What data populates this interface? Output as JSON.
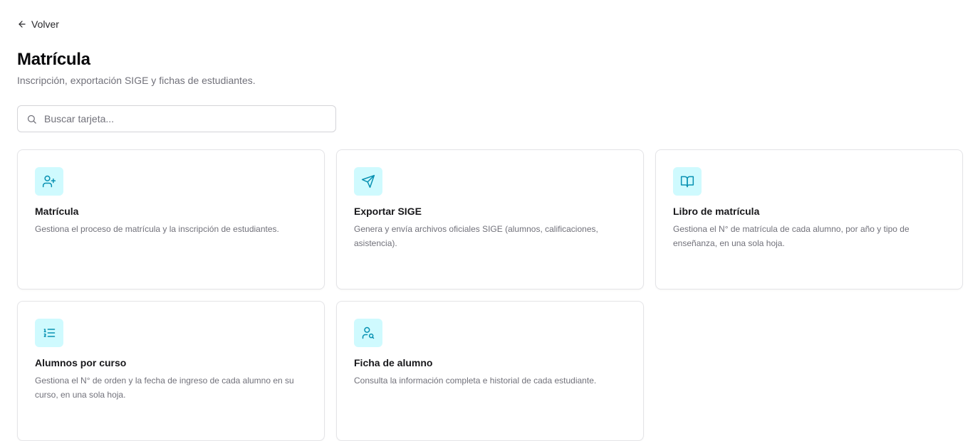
{
  "nav": {
    "back_label": "Volver",
    "back_icon": "arrow-left-icon"
  },
  "header": {
    "title": "Matrícula",
    "subtitle": "Inscripción, exportación SIGE y fichas de estudiantes."
  },
  "search": {
    "placeholder": "Buscar tarjeta...",
    "value": "",
    "icon": "search-icon"
  },
  "colors": {
    "accent": "#0891b2",
    "icon_tile_bg": "#cffafe"
  },
  "cards": [
    {
      "icon": "user-plus-icon",
      "title": "Matrícula",
      "description": "Gestiona el proceso de matrícula y la inscripción de estudiantes."
    },
    {
      "icon": "send-icon",
      "title": "Exportar SIGE",
      "description": "Genera y envía archivos oficiales SIGE (alumnos, calificaciones, asistencia)."
    },
    {
      "icon": "book-open-icon",
      "title": "Libro de matrícula",
      "description": "Gestiona el N° de matrícula de cada alumno, por año y tipo de enseñanza, en una sola hoja."
    },
    {
      "icon": "list-ordered-icon",
      "title": "Alumnos por curso",
      "description": "Gestiona el N° de orden y la fecha de ingreso de cada alumno en su curso, en una sola hoja."
    },
    {
      "icon": "user-search-icon",
      "title": "Ficha de alumno",
      "description": "Consulta la información completa e historial de cada estudiante."
    }
  ]
}
